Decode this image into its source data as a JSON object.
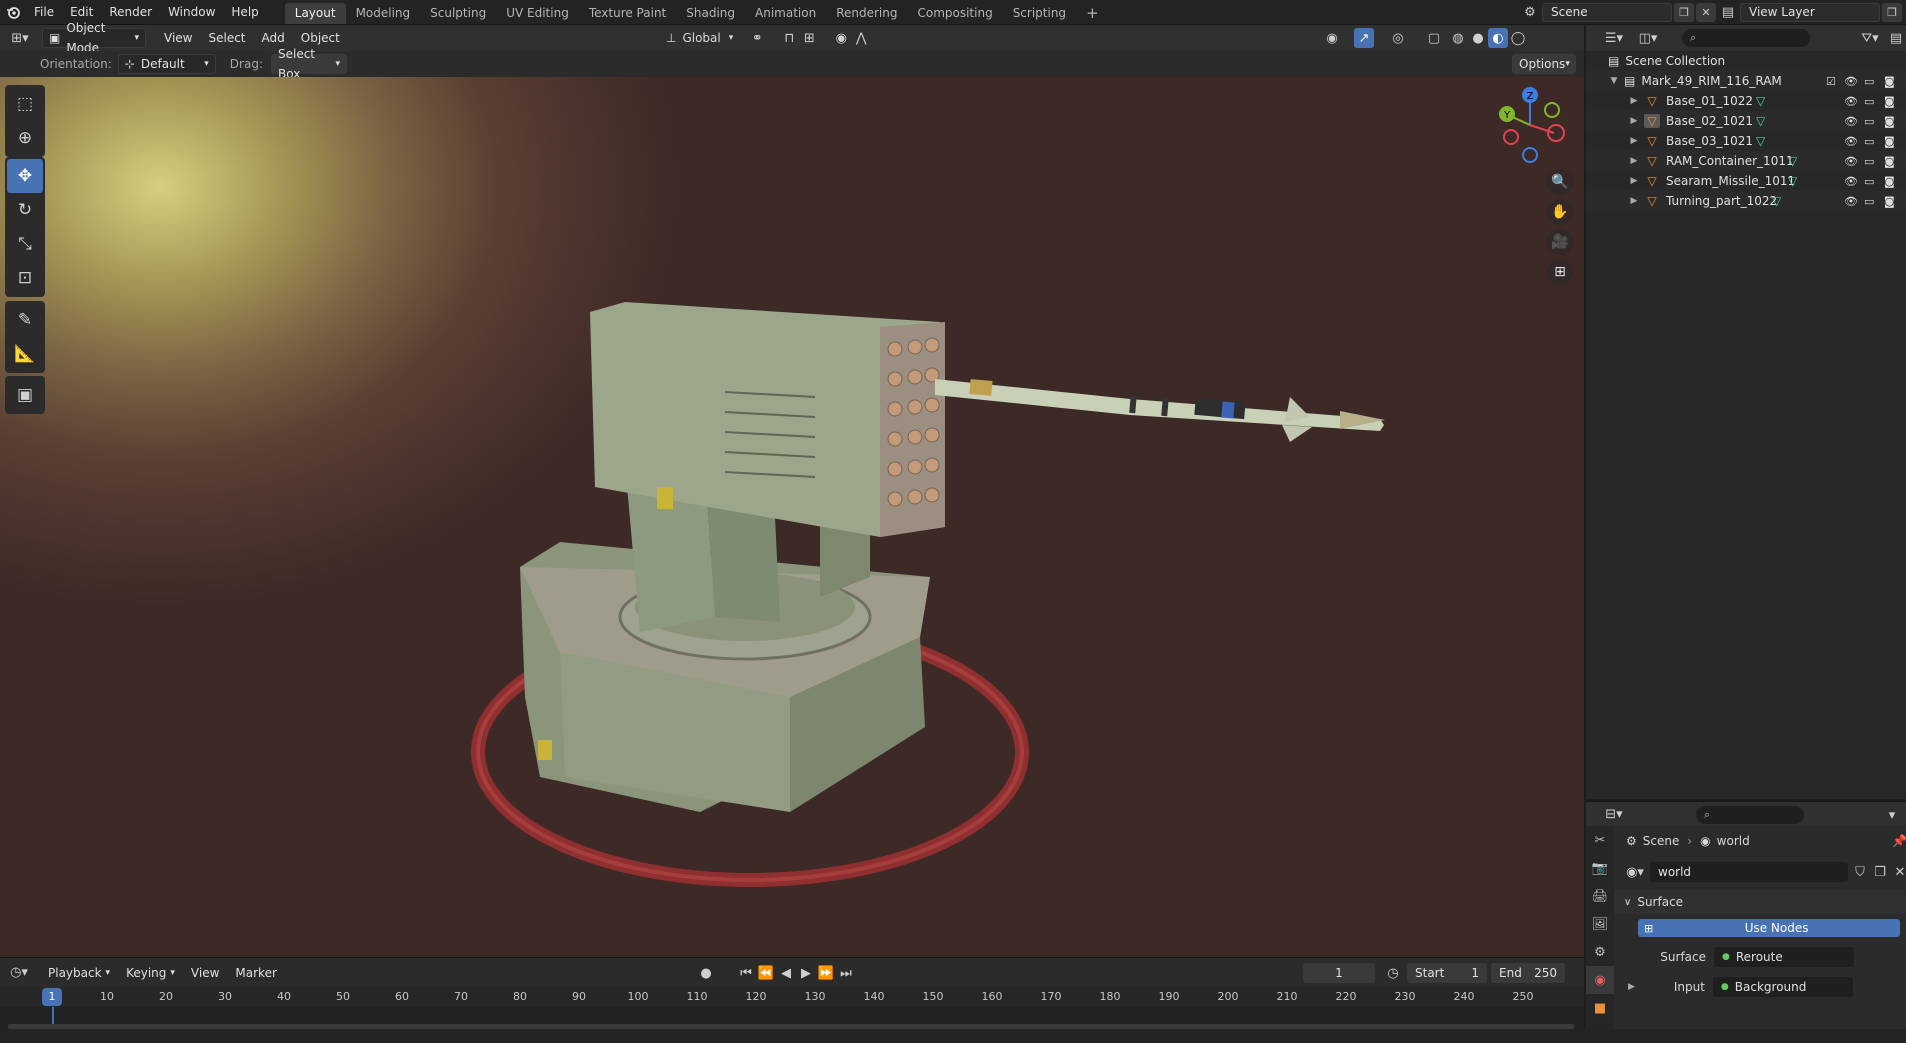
{
  "menu": {
    "items": [
      "File",
      "Edit",
      "Render",
      "Window",
      "Help"
    ]
  },
  "workspaces": {
    "tabs": [
      "Layout",
      "Modeling",
      "Sculpting",
      "UV Editing",
      "Texture Paint",
      "Shading",
      "Animation",
      "Rendering",
      "Compositing",
      "Scripting"
    ],
    "add": "+"
  },
  "scene_selector": {
    "value": "Scene"
  },
  "view_layer": {
    "value": "View Layer"
  },
  "viewport_header": {
    "mode": "Object Mode",
    "menus": [
      "View",
      "Select",
      "Add",
      "Object"
    ],
    "transform_orientation": "Global"
  },
  "tool_settings": {
    "orientation_label": "Orientation:",
    "orientation_value": "Default",
    "drag_label": "Drag:",
    "drag_value": "Select Box",
    "options": "Options"
  },
  "gizmo": {
    "x": "X",
    "y": "Y",
    "z": "Z"
  },
  "timeline": {
    "menus": [
      "Playback",
      "Keying",
      "View",
      "Marker"
    ],
    "current_frame": "1",
    "start_label": "Start",
    "start_value": "1",
    "end_label": "End",
    "end_value": "250",
    "ruler_marks": [
      "1",
      "10",
      "20",
      "30",
      "40",
      "50",
      "60",
      "70",
      "80",
      "90",
      "100",
      "110",
      "120",
      "130",
      "140",
      "150",
      "160",
      "170",
      "180",
      "190",
      "200",
      "210",
      "220",
      "230",
      "240",
      "250"
    ]
  },
  "outliner": {
    "root": "Scene Collection",
    "collection": "Mark_49_RIM_116_RAM",
    "objects": [
      "Base_01_1022",
      "Base_02_1021",
      "Base_03_1021",
      "RAM_Container_1011",
      "Searam_Missile_1011",
      "Turning_part_1022"
    ]
  },
  "properties": {
    "breadcrumb_scene": "Scene",
    "breadcrumb_world": "world",
    "world_name": "world",
    "panel_title": "Surface",
    "use_nodes": "Use Nodes",
    "surface_label": "Surface",
    "surface_value": "Reroute",
    "input_label": "Input",
    "input_value": "Background"
  },
  "colors": {
    "accent": "#4772b3",
    "outliner_mesh": "#e8913a",
    "outliner_data": "#4fd1a5",
    "axis_x": "#e0454f",
    "axis_y": "#80b82a",
    "axis_z": "#3d7ee0"
  }
}
